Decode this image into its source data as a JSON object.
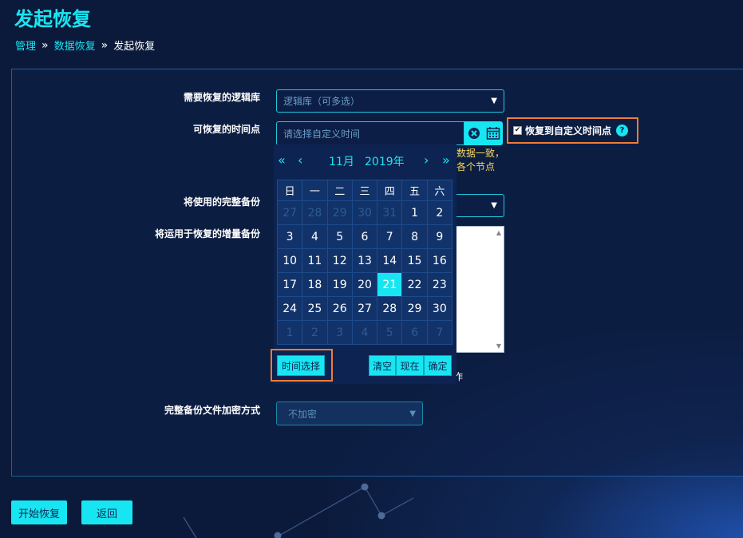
{
  "page": {
    "title": "发起恢复"
  },
  "breadcrumb": {
    "items": [
      "管理",
      "数据恢复"
    ],
    "current": "发起恢复",
    "separator": "»"
  },
  "form": {
    "db_label": "需要恢复的逻辑库",
    "db_placeholder": "逻辑库（可多选）",
    "time_label": "可恢复的时间点",
    "time_placeholder": "请选择自定义时间",
    "custom_time_label": "恢复到自定义时间点",
    "custom_time_checked": true,
    "hint_line1": "数据一致，",
    "hint_line2": "各个节点",
    "full_backup_label": "将使用的完整备份",
    "incremental_label": "将运用于恢复的增量备份",
    "under_text": "作",
    "encrypt_label": "完整备份文件加密方式",
    "encrypt_value": "不加密"
  },
  "calendar": {
    "month": "11月",
    "year": "2019年",
    "weekdays": [
      "日",
      "一",
      "二",
      "三",
      "四",
      "五",
      "六"
    ],
    "weeks": [
      [
        "27",
        "28",
        "29",
        "30",
        "31",
        "1",
        "2"
      ],
      [
        "3",
        "4",
        "5",
        "6",
        "7",
        "8",
        "9"
      ],
      [
        "10",
        "11",
        "12",
        "13",
        "14",
        "15",
        "16"
      ],
      [
        "17",
        "18",
        "19",
        "20",
        "21",
        "22",
        "23"
      ],
      [
        "24",
        "25",
        "26",
        "27",
        "28",
        "29",
        "30"
      ],
      [
        "1",
        "2",
        "3",
        "4",
        "5",
        "6",
        "7"
      ]
    ],
    "selected_day": "21",
    "time_select_label": "时间选择",
    "clear_label": "清空",
    "now_label": "现在",
    "confirm_label": "确定"
  },
  "actions": {
    "start_label": "开始恢复",
    "back_label": "返回"
  },
  "colors": {
    "accent": "#17e6f2",
    "highlight": "#f07c34",
    "hint": "#f6d85c",
    "background": "#0b1a3a"
  },
  "icons": [
    "clear-circle-icon",
    "calendar-icon",
    "help-icon",
    "dropdown-arrow-icon",
    "double-left-icon",
    "left-icon",
    "right-icon",
    "double-right-icon"
  ]
}
